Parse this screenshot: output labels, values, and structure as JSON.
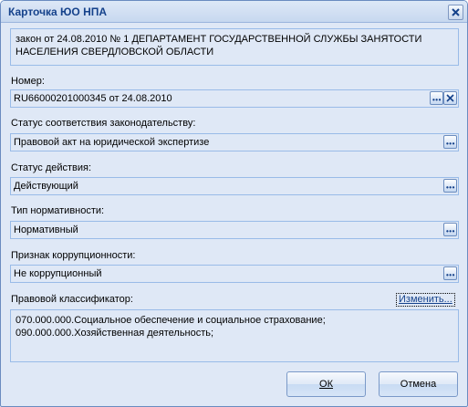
{
  "window": {
    "title": "Карточка ЮО НПА"
  },
  "header_text": "закон от 24.08.2010 № 1 ДЕПАРТАМЕНТ ГОСУДАРСТВЕННОЙ СЛУЖБЫ ЗАНЯТОСТИ\nНАСЕЛЕНИЯ СВЕРДЛОВСКОЙ ОБЛАСТИ",
  "fields": {
    "number": {
      "label": "Номер:",
      "value": "RU66000201000345 от 24.08.2010"
    },
    "compliance_status": {
      "label": "Статус соответствия законодательству:",
      "value": "Правовой акт на юридической экспертизе"
    },
    "action_status": {
      "label": "Статус действия:",
      "value": "Действующий"
    },
    "norm_type": {
      "label": "Тип нормативности:",
      "value": "Нормативный"
    },
    "corruption": {
      "label": "Признак коррупционности:",
      "value": "Не коррупционный"
    }
  },
  "classifier": {
    "label": "Правовой классификатор:",
    "change_link": "Изменить...",
    "text": "070.000.000.Социальное обеспечение и социальное страхование;\n090.000.000.Хозяйственная деятельность;"
  },
  "buttons": {
    "ok": "ОК",
    "cancel": "Отмена"
  },
  "icons": {
    "close": "close-icon",
    "browse": "ellipsis-icon",
    "clear": "clear-x-icon"
  },
  "colors": {
    "panel": "#dfe8f6",
    "border": "#99bbe8",
    "title_text": "#15428b"
  }
}
